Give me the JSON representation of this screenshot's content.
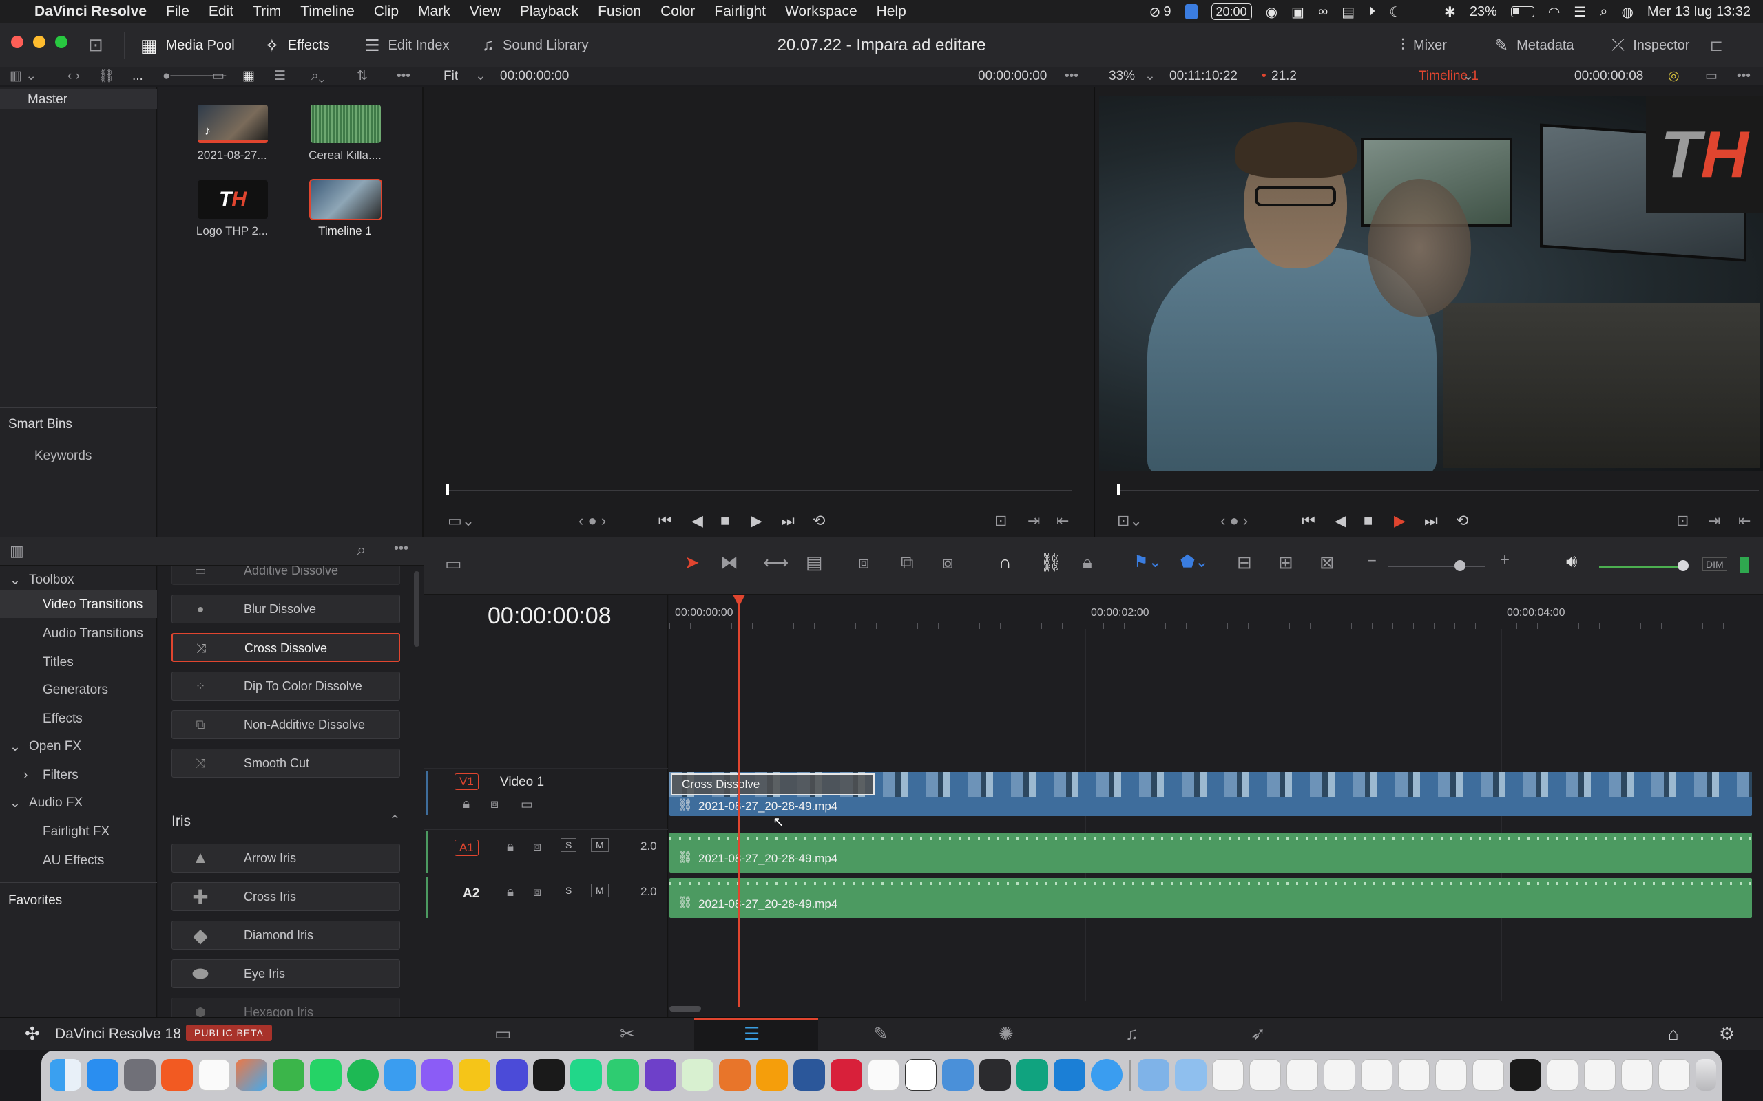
{
  "menubar": {
    "app_name": "DaVinci Resolve",
    "items": [
      "File",
      "Edit",
      "Trim",
      "Timeline",
      "Clip",
      "Mark",
      "View",
      "Playback",
      "Fusion",
      "Color",
      "Fairlight",
      "Workspace",
      "Help"
    ],
    "status": {
      "badge_count": "9",
      "clock_box": "20:00",
      "battery": "23%",
      "datetime": "Mer 13 lug  13:32"
    }
  },
  "toolbar": {
    "media_pool": "Media Pool",
    "effects": "Effects",
    "edit_index": "Edit Index",
    "sound_library": "Sound Library",
    "project_title": "20.07.22 - Impara ad editare",
    "mixer": "Mixer",
    "metadata": "Metadata",
    "inspector": "Inspector"
  },
  "viewer_bar": {
    "dots": "...",
    "src_zoom": "Fit",
    "src_tc_left": "00:00:00:00",
    "src_tc_right": "00:00:00:00",
    "prg_zoom": "33%",
    "prg_duration": "00:11:10:22",
    "prg_fps": "21.2",
    "timeline_name": "Timeline 1",
    "prg_tc": "00:00:00:08"
  },
  "bins": {
    "master": "Master",
    "smart_bins": "Smart Bins",
    "keywords": "Keywords"
  },
  "media": [
    {
      "name": "2021-08-27..."
    },
    {
      "name": "Cereal Killa...."
    },
    {
      "name": "Logo THP 2..."
    },
    {
      "name": "Timeline 1"
    }
  ],
  "fx_tree": {
    "toolbox": "Toolbox",
    "video_transitions": "Video Transitions",
    "audio_transitions": "Audio Transitions",
    "titles": "Titles",
    "generators": "Generators",
    "effects": "Effects",
    "open_fx": "Open FX",
    "filters": "Filters",
    "audio_fx": "Audio FX",
    "fairlight_fx": "Fairlight FX",
    "au_effects": "AU Effects",
    "favorites": "Favorites"
  },
  "fx_list": {
    "dissolve": [
      "Additive Dissolve",
      "Blur Dissolve",
      "Cross Dissolve",
      "Dip To Color Dissolve",
      "Non-Additive Dissolve",
      "Smooth Cut"
    ],
    "iris_header": "Iris",
    "iris": [
      "Arrow Iris",
      "Cross Iris",
      "Diamond Iris",
      "Eye Iris",
      "Hexagon Iris"
    ]
  },
  "timeline": {
    "timecode": "00:00:00:08",
    "ruler": [
      "00:00:00:00",
      "00:00:02:00",
      "00:00:04:00"
    ],
    "v1_badge": "V1",
    "v1_name": "Video 1",
    "a1_badge": "A1",
    "a2_badge": "A2",
    "a1_level": "2.0",
    "a2_level": "2.0",
    "solo": "S",
    "mute": "M",
    "transition_label": "Cross Dissolve",
    "clip_name": "2021-08-27_20-28-49.mp4"
  },
  "bottombar": {
    "app": "DaVinci Resolve 18",
    "badge": "PUBLIC BETA"
  },
  "colors": {
    "accent_red": "#e0452f",
    "video_clip": "#3e6d9c",
    "audio_clip": "#4c9a61",
    "playhead": "#e0452f"
  }
}
